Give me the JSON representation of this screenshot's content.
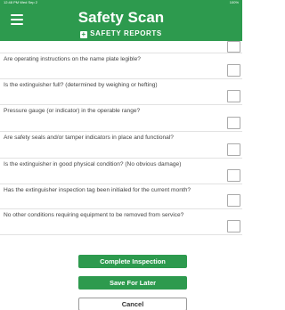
{
  "status_bar": {
    "left": "12:48 PM  Wed Sep 2",
    "right": "100%"
  },
  "header": {
    "title": "Safety Scan",
    "subtitle": "SAFETY REPORTS",
    "subtitle_icon": "plus-icon"
  },
  "questions": [
    "Are operating instructions on the name plate legible?",
    "Is the extinguisher full? (determined by weighing or hefting)",
    "Pressure gauge (or indicator) in the operable range?",
    "Are safety seals and/or tamper indicators in place and functional?",
    "Is the extinguisher in good physical condition? (No obvious damage)",
    "Has the extinguisher inspection tag been initialed for the current month?",
    "No other conditions requiring equipment to be removed from service?"
  ],
  "actions": {
    "complete": "Complete Inspection",
    "save": "Save For Later",
    "cancel": "Cancel"
  },
  "colors": {
    "brand_green": "#2d9a4e"
  }
}
